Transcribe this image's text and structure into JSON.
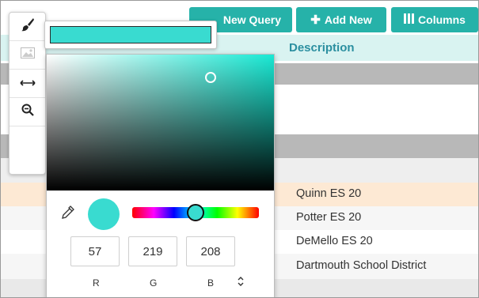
{
  "toolbar": {
    "new_query_label": "New Query",
    "add_new_label": "Add New",
    "add_new_icon": "plus-icon",
    "columns_label": "Columns",
    "columns_icon": "columns-icon",
    "accent_color": "#26b2a9"
  },
  "table": {
    "column_header": "Description",
    "rows": [
      "Quinn ES 20",
      "Potter ES 20",
      "DeMello ES 20",
      "Dartmouth School District"
    ],
    "highlight_color": "#fde9d4"
  },
  "rail": {
    "items": [
      "paint-brush-icon",
      "image-icon",
      "resize-horizontal-icon",
      "zoom-out-icon"
    ]
  },
  "color_picker": {
    "current_color": "#39dbd0",
    "rgb": {
      "r": "57",
      "g": "219",
      "b": "208"
    },
    "labels": {
      "r": "R",
      "g": "G",
      "b": "B"
    },
    "mode_toggle_icon": "up-down-chevron-icon",
    "eyedropper_icon": "eyedropper-icon"
  }
}
